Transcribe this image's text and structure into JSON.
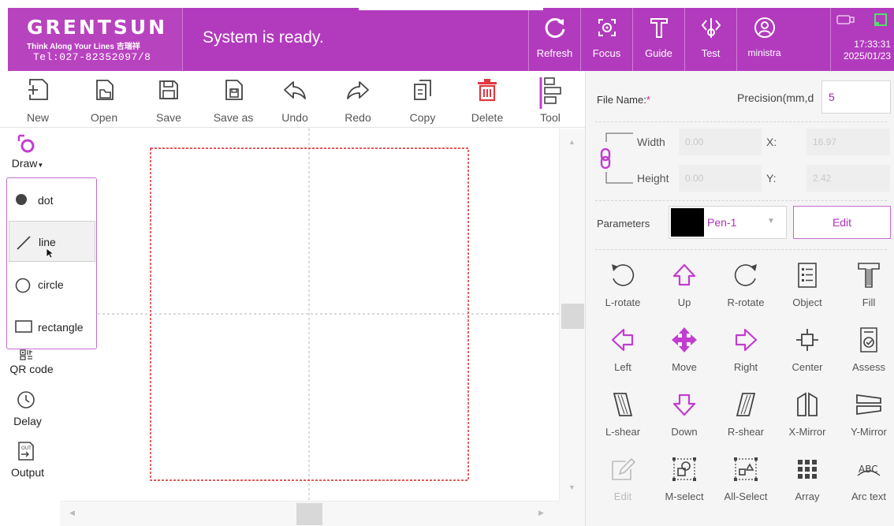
{
  "header": {
    "logo_main": "GRENTSUN",
    "logo_sub": "Think Along Your Lines 吉瑞祥",
    "logo_tel": "Tel:027-82352097/8",
    "status": "System is ready.",
    "buttons": [
      {
        "label": "Refresh",
        "icon": "refresh-icon"
      },
      {
        "label": "Focus",
        "icon": "focus-icon"
      },
      {
        "label": "Guide",
        "icon": "guide-icon"
      },
      {
        "label": "Test",
        "icon": "test-icon"
      },
      {
        "label": "ministra",
        "icon": "user-icon"
      }
    ],
    "time": "17:33:31",
    "date": "2025/01/23"
  },
  "toolbar": [
    {
      "label": "New",
      "icon": "new-file-icon"
    },
    {
      "label": "Open",
      "icon": "open-file-icon"
    },
    {
      "label": "Save",
      "icon": "save-icon"
    },
    {
      "label": "Save as",
      "icon": "save-as-icon"
    },
    {
      "label": "Undo",
      "icon": "undo-icon"
    },
    {
      "label": "Redo",
      "icon": "redo-icon"
    },
    {
      "label": "Copy",
      "icon": "copy-icon"
    },
    {
      "label": "Delete",
      "icon": "delete-icon"
    },
    {
      "label": "Tool",
      "icon": "tool-icon"
    }
  ],
  "left_tools": {
    "draw": "Draw",
    "qr": "QR code",
    "delay": "Delay",
    "output": "Output",
    "dropdown": [
      {
        "label": "dot",
        "icon": "dot-icon"
      },
      {
        "label": "line",
        "icon": "line-icon"
      },
      {
        "label": "circle",
        "icon": "circle-icon"
      },
      {
        "label": "rectangle",
        "icon": "rectangle-icon"
      }
    ]
  },
  "properties": {
    "file_name_label": "File Name:",
    "required_mark": "*",
    "precision_label": "Precision(mm,d",
    "precision_value": "5",
    "width_label": "Width",
    "width_value": "0.00",
    "height_label": "Height",
    "height_value": "0.00",
    "x_label": "X:",
    "x_value": "16.97",
    "y_label": "Y:",
    "y_value": "2.42",
    "parameters_label": "Parameters",
    "pen_value": "Pen-1",
    "edit_label": "Edit"
  },
  "transform_tools": [
    {
      "label": "L-rotate",
      "icon": "rotate-left-icon"
    },
    {
      "label": "Up",
      "icon": "arrow-up-icon"
    },
    {
      "label": "R-rotate",
      "icon": "rotate-right-icon"
    },
    {
      "label": "Object",
      "icon": "object-list-icon"
    },
    {
      "label": "Fill",
      "icon": "fill-icon"
    },
    {
      "label": "Left",
      "icon": "arrow-left-icon"
    },
    {
      "label": "Move",
      "icon": "move-icon"
    },
    {
      "label": "Right",
      "icon": "arrow-right-icon"
    },
    {
      "label": "Center",
      "icon": "center-icon"
    },
    {
      "label": "Assess",
      "icon": "assess-icon"
    },
    {
      "label": "L-shear",
      "icon": "shear-left-icon"
    },
    {
      "label": "Down",
      "icon": "arrow-down-icon"
    },
    {
      "label": "R-shear",
      "icon": "shear-right-icon"
    },
    {
      "label": "X-Mirror",
      "icon": "mirror-x-icon"
    },
    {
      "label": "Y-Mirror",
      "icon": "mirror-y-icon"
    },
    {
      "label": "Edit",
      "icon": "edit-node-icon"
    },
    {
      "label": "M-select",
      "icon": "multi-select-icon"
    },
    {
      "label": "All-Select",
      "icon": "select-all-icon"
    },
    {
      "label": "Array",
      "icon": "array-icon"
    },
    {
      "label": "Arc text",
      "icon": "arc-text-icon"
    }
  ],
  "colors": {
    "brand": "#b23bbd",
    "accent": "#c23cd0",
    "delete": "#e0393e",
    "marquee": "#e02020"
  }
}
